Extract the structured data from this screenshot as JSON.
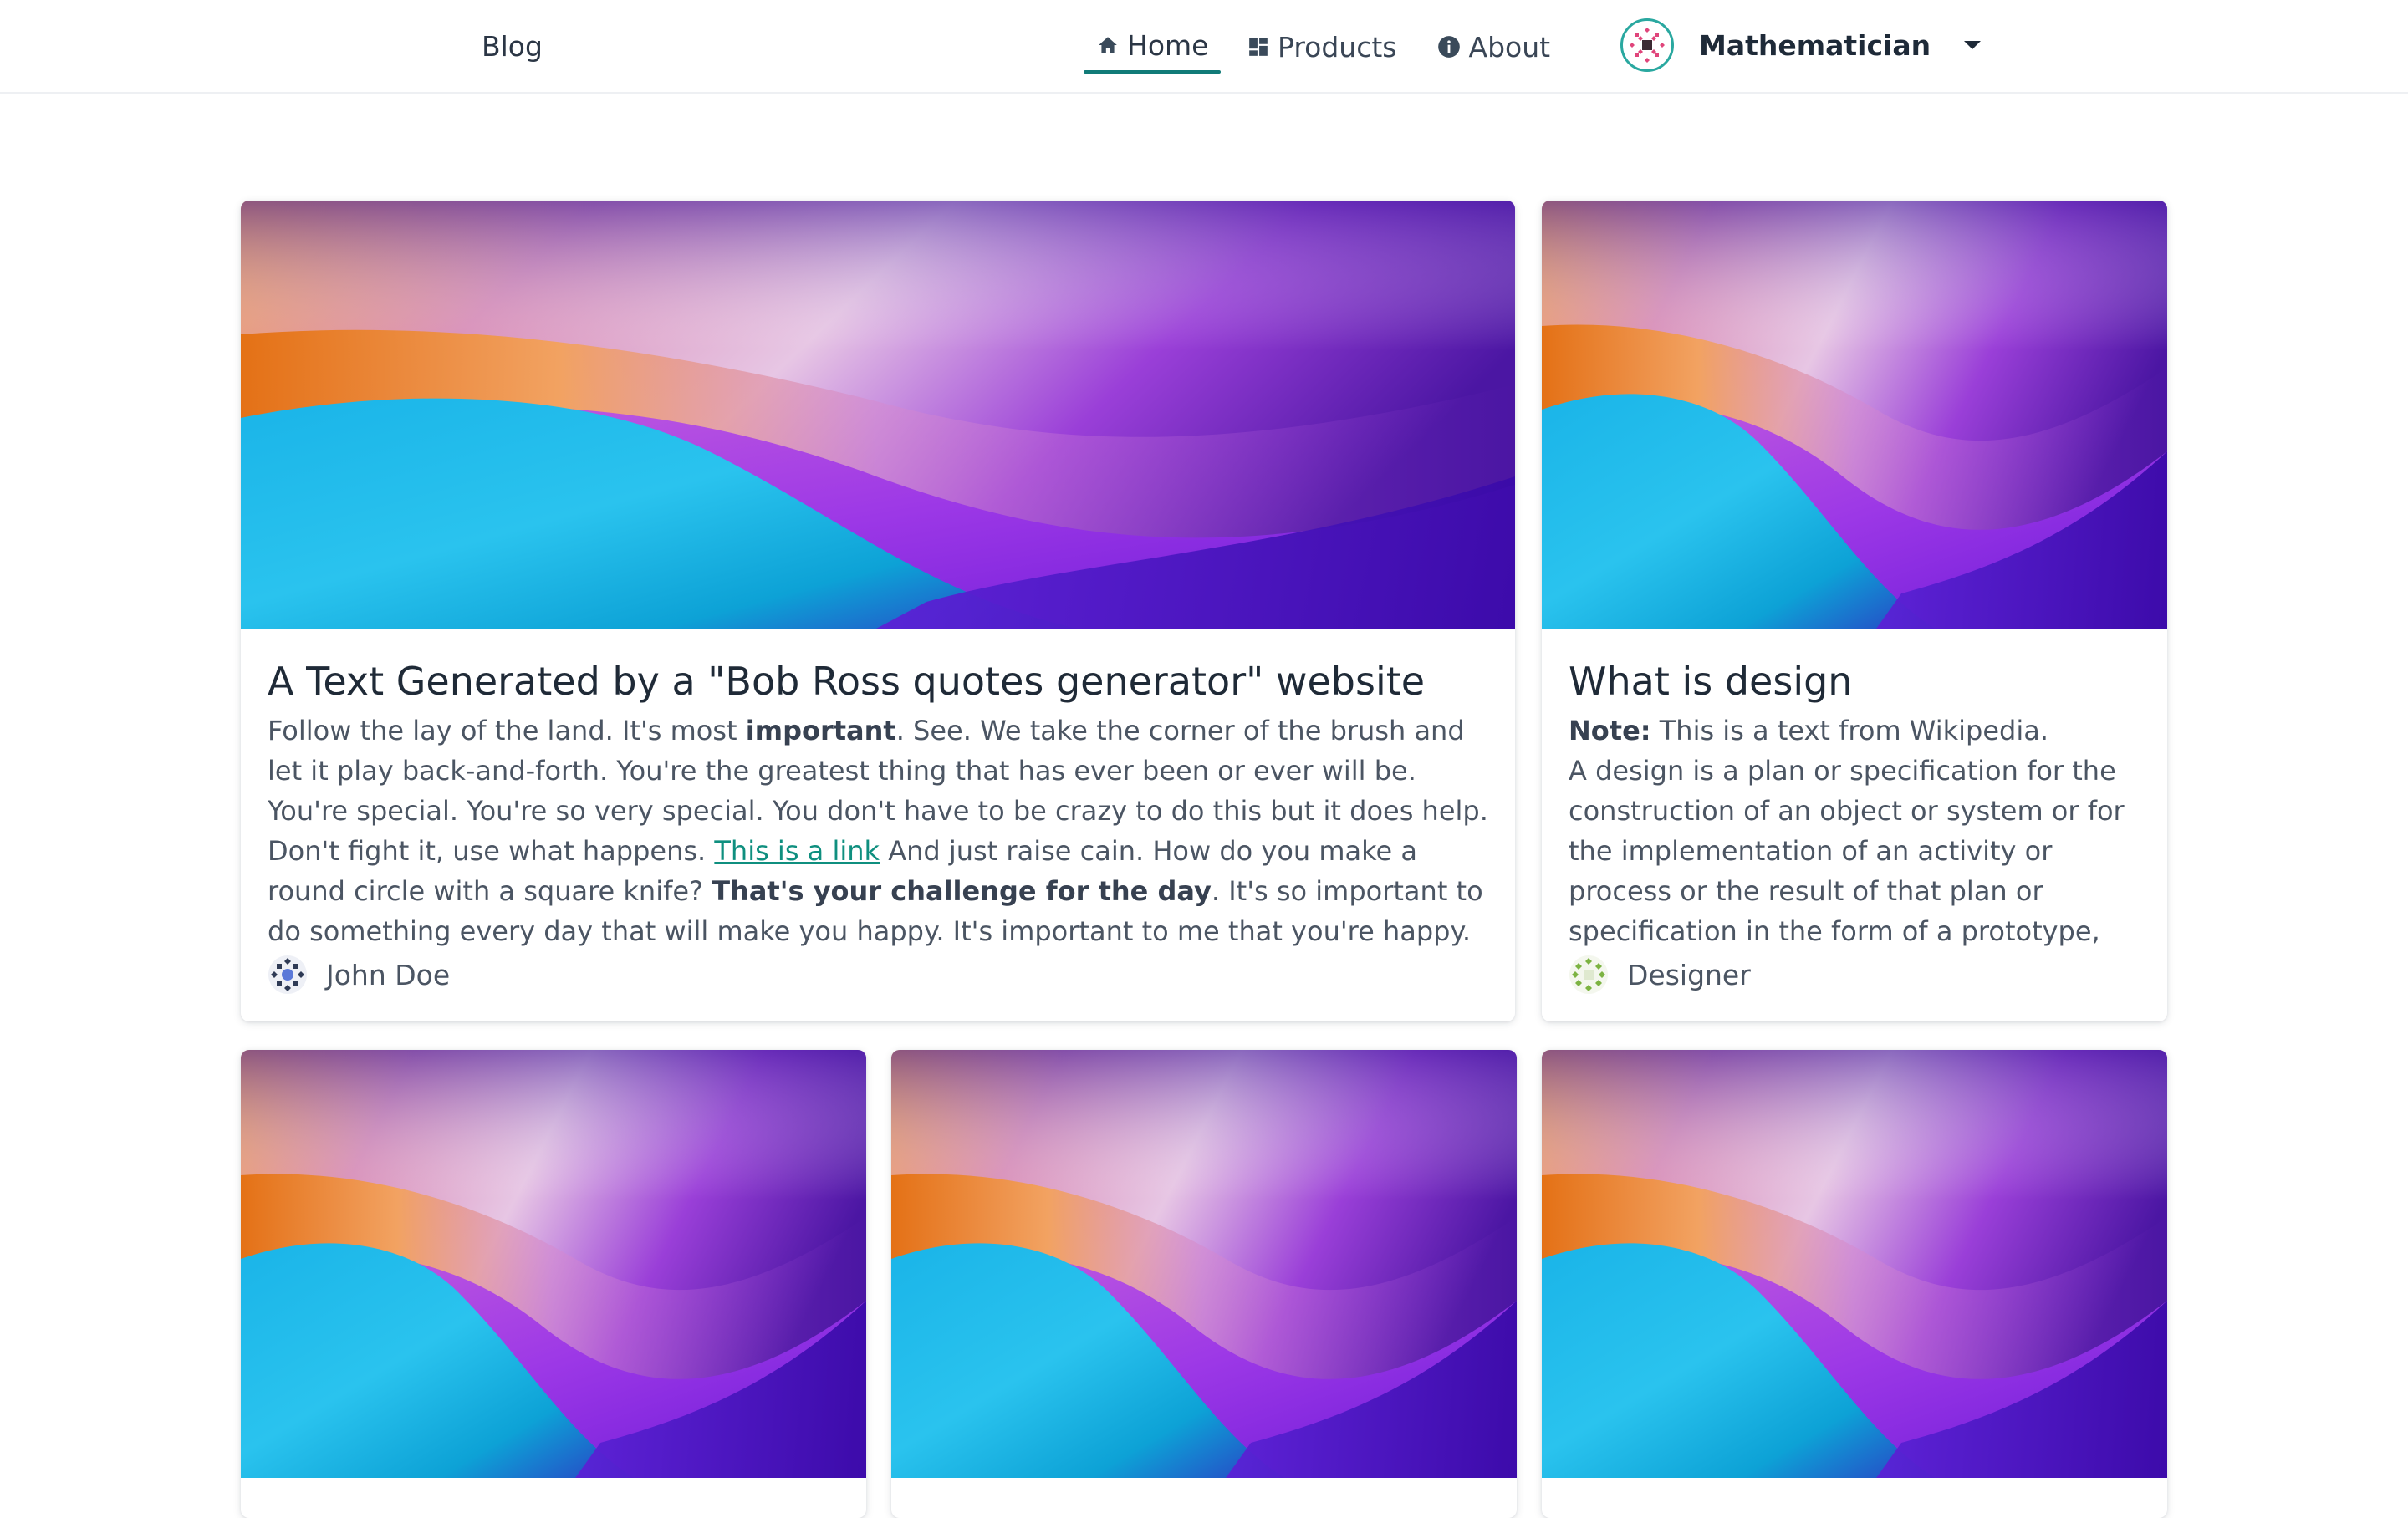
{
  "header": {
    "brand": "Blog",
    "nav": [
      {
        "label": "Home",
        "icon": "home-icon",
        "active": true
      },
      {
        "label": "Products",
        "icon": "grid-icon",
        "active": false
      },
      {
        "label": "About",
        "icon": "info-icon",
        "active": false
      }
    ],
    "account": {
      "name": "Mathematician",
      "avatar_icon": "identicon-avatar",
      "caret_icon": "caret-down-icon"
    }
  },
  "cards": [
    {
      "title": "A Text Generated by a \"Bob Ross quotes generator\" website",
      "text_parts": [
        {
          "t": "Follow the lay of the land. It's most "
        },
        {
          "t": "important",
          "b": true
        },
        {
          "t": ". See. We take the corner of the brush and let it play back-and-forth. You're the greatest thing that has ever been or ever will be. You're special. You're so very special. You don't have to be crazy to do this but it does help. Don't fight it, use what happens. "
        },
        {
          "t": "This is a link",
          "link": true
        },
        {
          "t": " And just raise cain. How do you make a round circle with a square knife? "
        },
        {
          "t": "That's your challenge for the day",
          "b": true
        },
        {
          "t": ". It's so important to do something every day that will make you happy. It's important to me that you're happy. Let's build an almighty mountain. A tre…"
        }
      ],
      "author": "John Doe"
    },
    {
      "title": "What is design",
      "text_parts": [
        {
          "t": "Note:",
          "b": true
        },
        {
          "t": " This is a text from Wikipedia."
        },
        {
          "br": true
        },
        {
          "t": "A design is a plan or specification for the construction of an object or system or for the implementation of an activity or process or the result of that plan or specification in the form of a prototype, product, or process. T…"
        }
      ],
      "author": "Designer"
    }
  ],
  "colors": {
    "accent": "#117b78",
    "link": "#0f8f7f",
    "avatar_ring": "#2aa8a0"
  }
}
